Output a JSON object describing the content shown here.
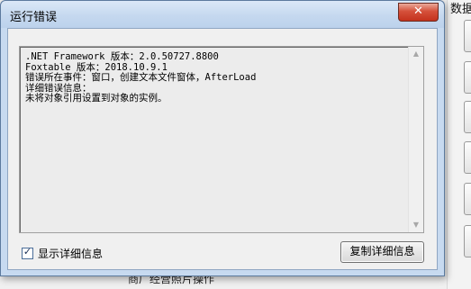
{
  "background": {
    "top_text": "数据",
    "bottom_text": "商厂经营照片操作"
  },
  "dialog": {
    "title": "运行错误",
    "close_glyph": "✕",
    "details_text": ".NET Framework 版本：2.0.50727.8800\nFoxtable 版本：2018.10.9.1\n错误所在事件：窗口，创建文本文件窗体，AfterLoad\n详细错误信息：\n未将对象引用设置到对象的实例。",
    "scroll_up_glyph": "▲",
    "scroll_down_glyph": "▼",
    "show_details_label": "显示详细信息",
    "show_details_checked": true,
    "check_glyph": "✓",
    "copy_button_label": "复制详细信息"
  }
}
